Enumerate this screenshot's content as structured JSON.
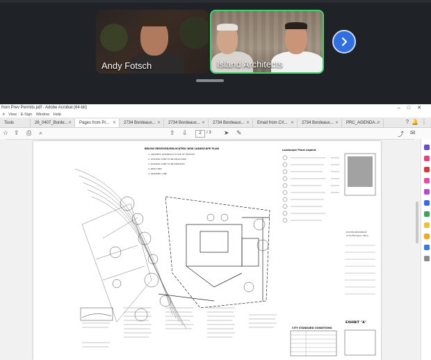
{
  "meeting": {
    "participants": [
      {
        "name": "Andy Fotsch"
      },
      {
        "name": "Island Architects"
      }
    ],
    "next_icon": "chevron-right-icon"
  },
  "acrobat": {
    "title": "from Prev Permits.pdf - Adobe Acrobat (64-bit)",
    "menu": [
      "it",
      "View",
      "E-Sign",
      "Window",
      "Help"
    ],
    "tools_label": "Tools",
    "tabs": [
      {
        "label": "26_0407_Borde..."
      },
      {
        "label": "Pages from Pr..."
      },
      {
        "label": "2734 Bordeaux..."
      },
      {
        "label": "2734 Bordeaux..."
      },
      {
        "label": "2734 Bordeaux..."
      },
      {
        "label": "Email from CX..."
      },
      {
        "label": "2734 Bordeaux..."
      },
      {
        "label": "PRC_AGENDA..."
      }
    ],
    "page_current": "2",
    "page_total": "/ 3"
  },
  "document": {
    "heading_lines": [
      "BELOW REMOVED/RELOCATED/ NEW LANDSCAPE PLAN",
      "1. ADDRESS: BORDEAUX PLACE OF DISTRICT",
      "2. EXISTING TREE TO BE RELOCATED",
      "3. EXISTING TREE TO BE REMOVED",
      "4. NEW TREE",
      "5. PROPERTY LINE"
    ],
    "legend_title": "Landscape Plant Legend",
    "project_title": "DUSTIN RESIDENCE",
    "project_sub": "2734 Bordeaux Place",
    "exhibit": "EXHIBIT \"A\"",
    "standard_title": "CITY STANDARD CONDITIONS"
  },
  "colors": {
    "active_speaker": "#3fd46b",
    "next_button": "#2f6fe0"
  }
}
